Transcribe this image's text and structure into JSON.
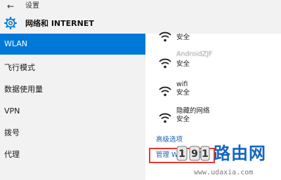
{
  "window": {
    "title": "设置",
    "back_label": "←"
  },
  "header": {
    "title": "网络和 INTERNET"
  },
  "sidebar": {
    "items": [
      {
        "label": "WLAN",
        "active": true
      },
      {
        "label": "飞行模式",
        "active": false
      },
      {
        "label": "数据使用量",
        "active": false
      },
      {
        "label": "VPN",
        "active": false
      },
      {
        "label": "拨号",
        "active": false
      },
      {
        "label": "代理",
        "active": false
      }
    ]
  },
  "networks": [
    {
      "name": "",
      "status": "安全"
    },
    {
      "name": "AndroidZJF",
      "status": "安全"
    },
    {
      "name": "wifi",
      "status": "安全"
    },
    {
      "name": "隐藏的网络",
      "status": "安全"
    }
  ],
  "links": {
    "advanced": "高级选项",
    "manage": "管理 Wi-Fi 设置"
  },
  "watermark": {
    "brand": "路由网",
    "url": "www.udaxia.com"
  },
  "colors": {
    "accent": "#0078d7",
    "link": "#1a5fb4",
    "highlight_box": "#e53935"
  }
}
